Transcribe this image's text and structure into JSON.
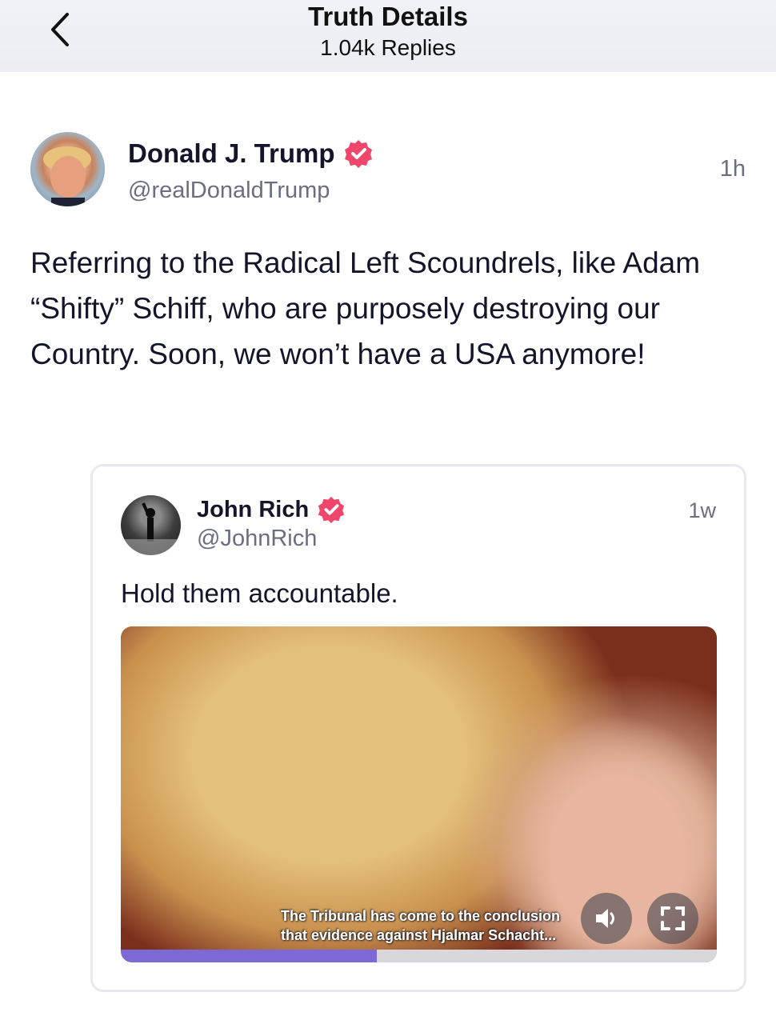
{
  "header": {
    "title": "Truth Details",
    "subtitle": "1.04k Replies",
    "back_icon": "chevron-left-icon"
  },
  "post": {
    "author_name": "Donald J. Trump",
    "handle": "@realDonaldTrump",
    "time": "1h",
    "verified_icon": "verified-badge-icon",
    "text": "Referring to the Radical Left Scoundrels, like Adam “Shifty” Schiff, who are purposely destroying our Country. Soon, we won’t have a USA anymore!"
  },
  "quoted_post": {
    "author_name": "John Rich",
    "handle": "@JohnRich",
    "time": "1w",
    "text": "Hold them accountable.",
    "video": {
      "caption_line1": "The Tribunal has come to the conclusion",
      "caption_line2": "that evidence against Hjalmar Schacht...",
      "progress_percent": 43,
      "sound_icon": "speaker-icon",
      "fullscreen_icon": "fullscreen-icon"
    }
  },
  "colors": {
    "verified_badge": "#f0466b",
    "progress": "#7d69d6",
    "muted_text": "#6b6e80"
  }
}
